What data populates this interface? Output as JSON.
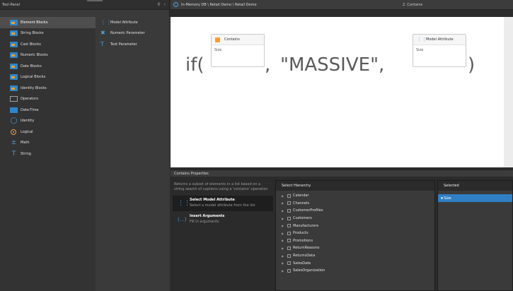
{
  "tool_panel": {
    "title": "Tool-Panel",
    "categories": [
      {
        "label": "Element Blocks",
        "icon": "element-block-icon",
        "selected": true
      },
      {
        "label": "String Blocks",
        "icon": "string-block-icon"
      },
      {
        "label": "Cast Blocks",
        "icon": "cast-block-icon"
      },
      {
        "label": "Numeric Blocks",
        "icon": "numeric-block-icon"
      },
      {
        "label": "Date Blocks",
        "icon": "date-block-icon"
      },
      {
        "label": "Logical Blocks",
        "icon": "logical-block-icon"
      },
      {
        "label": "Identity Blocks",
        "icon": "identity-block-icon"
      },
      {
        "label": "Operators",
        "icon": "operators-icon"
      },
      {
        "label": "Date-Time",
        "icon": "date-time-icon"
      },
      {
        "label": "Identity",
        "icon": "identity-icon"
      },
      {
        "label": "Logical",
        "icon": "logical-icon"
      },
      {
        "label": "Math",
        "icon": "math-icon"
      },
      {
        "label": "String",
        "icon": "string-icon"
      }
    ],
    "elements": [
      {
        "label": "Model Attribute",
        "icon": "model-attribute-icon"
      },
      {
        "label": "Numeric Parameter",
        "icon": "numeric-parameter-icon"
      },
      {
        "label": "Text Parameter",
        "icon": "text-parameter-icon"
      }
    ]
  },
  "breadcrumb": {
    "path": "In-Memory DB \\ Retail Demo \\ Retail Demo",
    "step": "2. Contains"
  },
  "formula": {
    "if_open": "if(",
    "comma1": ",",
    "string_literal": "\"MASSIVE\",",
    "close": ")",
    "slot1": {
      "title": "Contains",
      "body": "Size"
    },
    "slot2": {
      "title": "Model Attribute",
      "body": "Size"
    }
  },
  "properties": {
    "header": "Contains Properties",
    "description": "Returns a subset of elements in a list based on a string search of captions using a 'contains' operation",
    "options": [
      {
        "title": "Select Model Attribute",
        "subtitle": "Select a model attribute from the list",
        "selected": true
      },
      {
        "title": "Insert Arguments",
        "subtitle": "Fill in arguments",
        "selected": false
      }
    ]
  },
  "hierarchy": {
    "title": "Select Hierarchy",
    "items": [
      "Calendar",
      "Channels",
      "CustomerProfiles",
      "Customers",
      "Manufacturers",
      "Products",
      "Promotions",
      "ReturnReasons",
      "ReturnsData",
      "SalesDate",
      "SalesOrganization"
    ]
  },
  "selected_panel": {
    "title": "Selected",
    "items": [
      "Size"
    ]
  },
  "colors": {
    "accent": "#2f7fc4",
    "block_orange": "#ff9d2a",
    "icon_blue": "#4a9fde"
  }
}
